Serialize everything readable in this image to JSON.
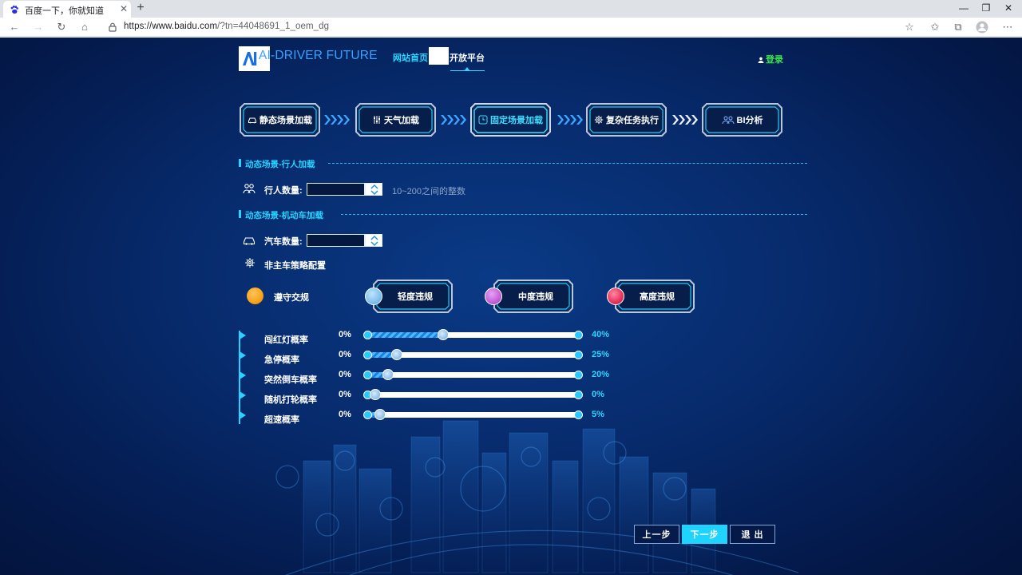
{
  "browser": {
    "tab_title": "百度一下，你就知道",
    "new_tab": "+",
    "tab_close": "✕",
    "url_main": "https://www.baidu.com",
    "url_rest": "/?tn=44048691_1_oem_dg",
    "win_minimize": "—",
    "win_restore": "❐",
    "win_close": "✕"
  },
  "header": {
    "logo_text": "AI-DRIVER FUTURE",
    "nav_home": "网站首页",
    "nav_open": "开放平台",
    "login": "登录"
  },
  "steps": [
    {
      "label": "静态场景加载",
      "icon": "car-icon"
    },
    {
      "label": "天气加载",
      "icon": "sliders-icon"
    },
    {
      "label": "固定场景加载",
      "icon": "clock-icon",
      "active": true
    },
    {
      "label": "复杂任务执行",
      "icon": "gear-icon"
    },
    {
      "label": "BI分析",
      "icon": "people-icon"
    }
  ],
  "section_pedestrian": {
    "title": "动态场景-行人加载",
    "label": "行人数量:",
    "value": "",
    "hint": "10~200之间的整数"
  },
  "section_vehicle": {
    "title": "动态场景-机动车加载",
    "label": "汽车数量:",
    "value": "",
    "strategy_label": "非主车策略配置"
  },
  "violations": {
    "obey": {
      "label": "遵守交规",
      "color": "#f7a21b"
    },
    "light": {
      "label": "轻度违规",
      "color": "#7fc0ec"
    },
    "medium": {
      "label": "中度违规",
      "color": "#c35fd8"
    },
    "heavy": {
      "label": "高度违规",
      "color": "#e8305a"
    }
  },
  "sliders": [
    {
      "label": "闯红灯概率",
      "min": "0%",
      "value": "40%",
      "level": 0.36
    },
    {
      "label": "急停概率",
      "min": "0%",
      "value": "25%",
      "level": 0.14
    },
    {
      "label": "突然倒车概率",
      "min": "0%",
      "value": "20%",
      "level": 0.1
    },
    {
      "label": "随机打轮概率",
      "min": "0%",
      "value": "0%",
      "level": 0.04
    },
    {
      "label": "超速概率",
      "min": "0%",
      "value": "5%",
      "level": 0.065
    }
  ],
  "buttons": {
    "prev": "上一步",
    "next": "下一步",
    "exit": "退 出"
  },
  "colors": {
    "accent": "#29d2ff",
    "login": "#3ae84a",
    "bg": "#072a6b"
  }
}
